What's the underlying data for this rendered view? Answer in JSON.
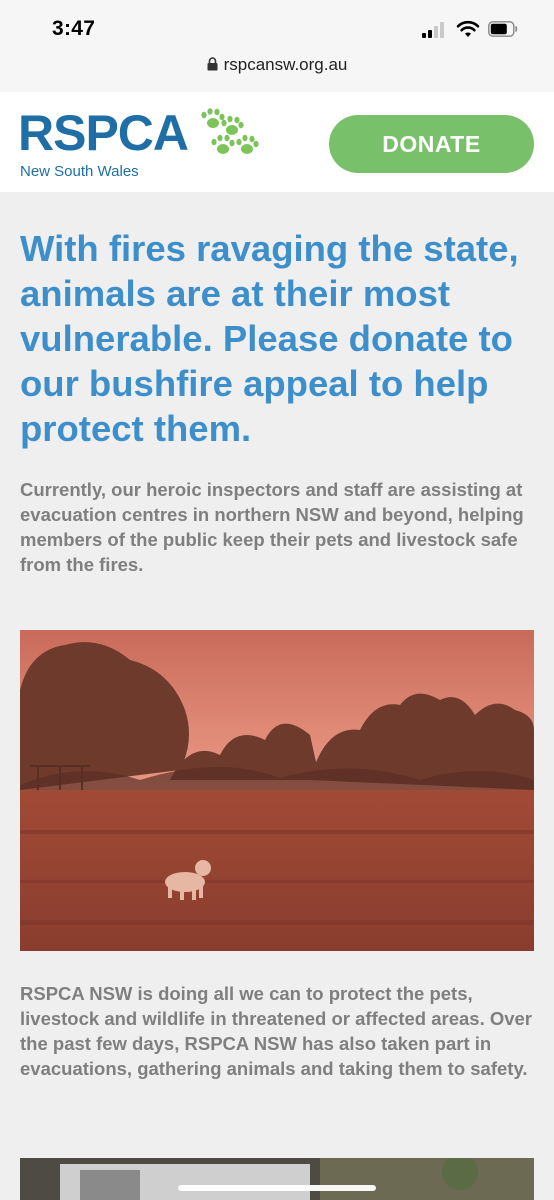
{
  "status_bar": {
    "time": "3:47"
  },
  "browser": {
    "url": "rspcansw.org.au"
  },
  "header": {
    "logo_text": "RSPCA",
    "logo_subtitle": "New South Wales",
    "donate_label": "DONATE"
  },
  "content": {
    "headline": "With fires ravaging the state, animals are at their most vulnerable. Please donate to our bushfire appeal to help protect them.",
    "intro": "Currently, our heroic inspectors and staff are assisting at evacuation centres in northern NSW and beyond, helping members of the public keep their pets and livestock safe from the fires.",
    "body": "RSPCA NSW is doing all we can to protect the pets, livestock and wildlife in threatened or affected areas. Over the past few days, RSPCA NSW has also taken part in evacuations, gathering animals and taking them to safety."
  },
  "colors": {
    "brand_blue": "#1f6ea6",
    "headline_blue": "#3d8fcc",
    "donate_green": "#78c06a",
    "paw_green": "#7cc35a",
    "body_gray": "#7f7f7f"
  }
}
